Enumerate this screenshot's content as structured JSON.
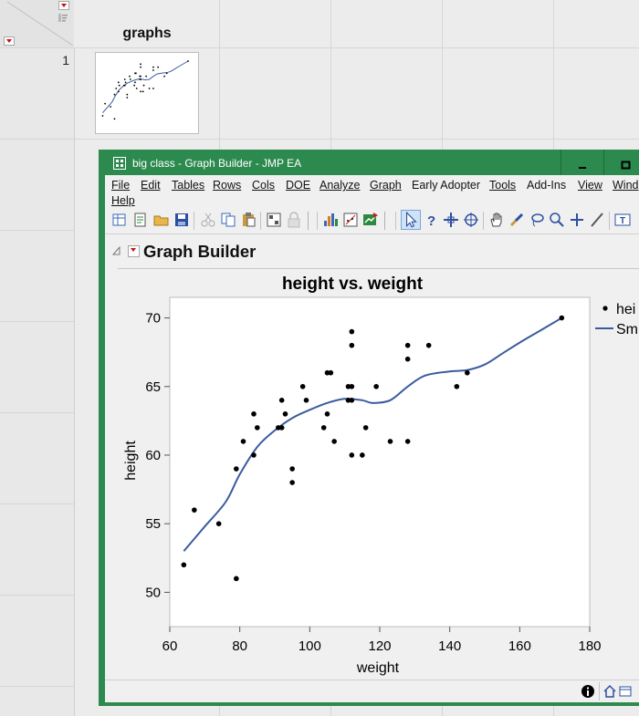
{
  "table": {
    "column_header": "graphs",
    "row_number": "1"
  },
  "window": {
    "title": "big class - Graph Builder - JMP EA",
    "minimize_label": "–",
    "maximize_label": "□"
  },
  "menu": {
    "items": [
      {
        "label": "File"
      },
      {
        "label": "Edit"
      },
      {
        "label": "Tables"
      },
      {
        "label": "Rows"
      },
      {
        "label": "Cols"
      },
      {
        "label": "DOE"
      },
      {
        "label": "Analyze"
      },
      {
        "label": "Graph"
      },
      {
        "label": "Early Adopter"
      },
      {
        "label": "Tools"
      },
      {
        "label": "Add-Ins"
      },
      {
        "label": "View"
      },
      {
        "label": "Wind"
      },
      {
        "label": "Help"
      }
    ]
  },
  "graph_builder": {
    "header": "Graph Builder"
  },
  "legend": {
    "points_label": "hei",
    "smoother_label": "Sm"
  },
  "colors": {
    "window_frame": "#2d8a4e",
    "smoother": "#3a5ba0",
    "points": "#000000"
  },
  "chart_data": {
    "type": "scatter",
    "title": "height vs. weight",
    "xlabel": "weight",
    "ylabel": "height",
    "xlim": [
      60,
      180
    ],
    "ylim": [
      47.5,
      71.5
    ],
    "x_ticks": [
      60,
      80,
      100,
      120,
      140,
      160,
      180
    ],
    "y_ticks": [
      50,
      55,
      60,
      65,
      70
    ],
    "grid": false,
    "legend_position": "right",
    "points": [
      [
        64,
        52
      ],
      [
        67,
        56
      ],
      [
        74,
        55
      ],
      [
        79,
        51
      ],
      [
        79,
        59
      ],
      [
        81,
        61
      ],
      [
        84,
        60
      ],
      [
        84,
        63
      ],
      [
        85,
        62
      ],
      [
        91,
        62
      ],
      [
        92,
        62
      ],
      [
        92,
        64
      ],
      [
        93,
        63
      ],
      [
        95,
        58
      ],
      [
        95,
        59
      ],
      [
        98,
        65
      ],
      [
        99,
        64
      ],
      [
        104,
        62
      ],
      [
        105,
        63
      ],
      [
        105,
        66
      ],
      [
        106,
        66
      ],
      [
        107,
        61
      ],
      [
        111,
        65
      ],
      [
        111,
        64
      ],
      [
        112,
        65
      ],
      [
        112,
        60
      ],
      [
        112,
        68
      ],
      [
        112,
        69
      ],
      [
        112,
        64
      ],
      [
        115,
        60
      ],
      [
        116,
        62
      ],
      [
        119,
        65
      ],
      [
        123,
        61
      ],
      [
        128,
        61
      ],
      [
        128,
        67
      ],
      [
        128,
        68
      ],
      [
        134,
        68
      ],
      [
        142,
        65
      ],
      [
        145,
        66
      ],
      [
        172,
        70
      ]
    ],
    "smoother": [
      [
        64,
        53.0
      ],
      [
        70,
        54.8
      ],
      [
        76,
        56.6
      ],
      [
        80,
        58.6
      ],
      [
        85,
        60.6
      ],
      [
        90,
        61.8
      ],
      [
        95,
        62.7
      ],
      [
        100,
        63.3
      ],
      [
        105,
        63.8
      ],
      [
        110,
        64.1
      ],
      [
        115,
        64.0
      ],
      [
        118,
        63.8
      ],
      [
        123,
        64.0
      ],
      [
        128,
        65.0
      ],
      [
        133,
        65.8
      ],
      [
        140,
        66.1
      ],
      [
        145,
        66.2
      ],
      [
        150,
        66.6
      ],
      [
        155,
        67.4
      ],
      [
        160,
        68.2
      ],
      [
        166,
        69.1
      ],
      [
        172,
        70.0
      ]
    ]
  }
}
